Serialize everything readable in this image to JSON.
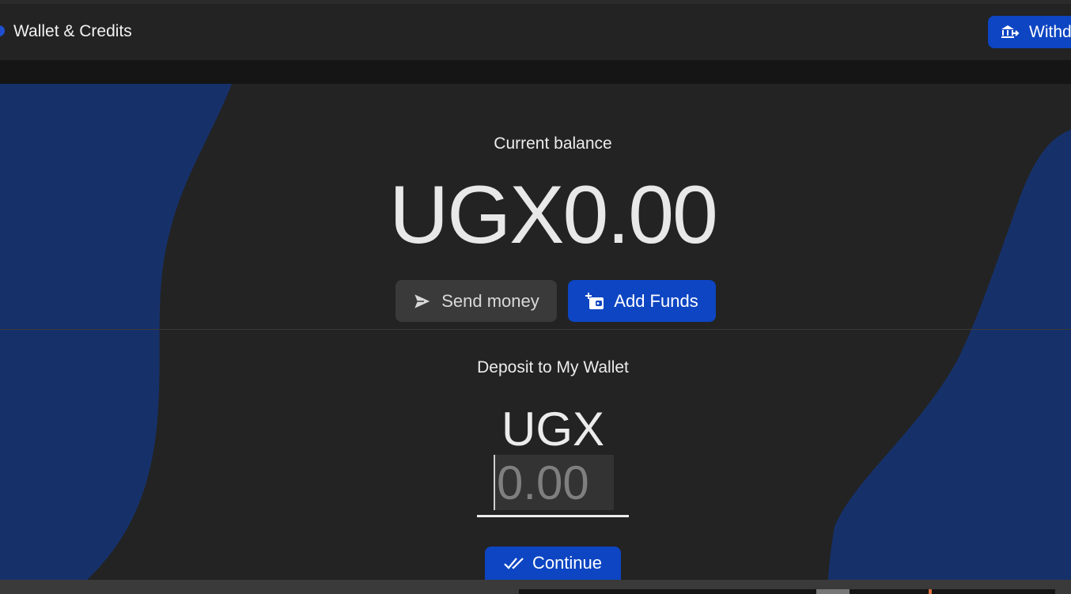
{
  "header": {
    "title": "Wallet & Credits",
    "withdraw_label": "Withdraw"
  },
  "balance": {
    "label": "Current balance",
    "amount": "UGX0.00"
  },
  "actions": {
    "send_label": "Send money",
    "add_label": "Add Funds"
  },
  "deposit": {
    "title": "Deposit to My Wallet",
    "currency": "UGX",
    "amount_placeholder": "0.00",
    "continue_label": "Continue"
  },
  "icons": {
    "withdraw": "bank-transfer-icon",
    "send": "send-arrow-icon",
    "add": "wallet-plus-icon",
    "continue": "double-check-icon"
  },
  "colors": {
    "accent": "#0d45c2",
    "blob": "#16316a",
    "panel": "#232323"
  }
}
